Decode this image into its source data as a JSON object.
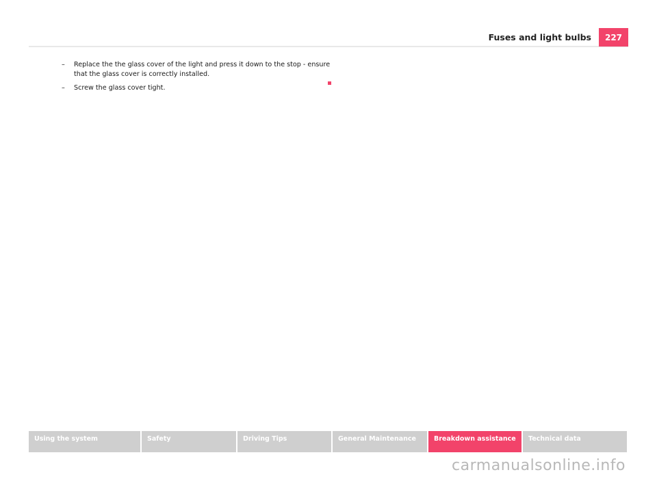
{
  "header": {
    "section_title": "Fuses and light bulbs",
    "page_number": "227"
  },
  "steps": [
    {
      "marker": "–",
      "text": "Replace the the glass cover of the light and press it down to the stop - ensure that the glass cover is correctly installed."
    },
    {
      "marker": "–",
      "text": "Screw the glass cover tight."
    }
  ],
  "footer_nav": {
    "tabs": [
      {
        "label": "Using the system",
        "active": false
      },
      {
        "label": "Safety",
        "active": false
      },
      {
        "label": "Driving Tips",
        "active": false
      },
      {
        "label": "General Maintenance",
        "active": false
      },
      {
        "label": "Breakdown assistance",
        "active": true
      },
      {
        "label": "Technical data",
        "active": false
      }
    ]
  },
  "watermark": "carmanualsonline.info",
  "colors": {
    "accent": "#f2436a",
    "inactive_tab": "#cfcfcf"
  }
}
